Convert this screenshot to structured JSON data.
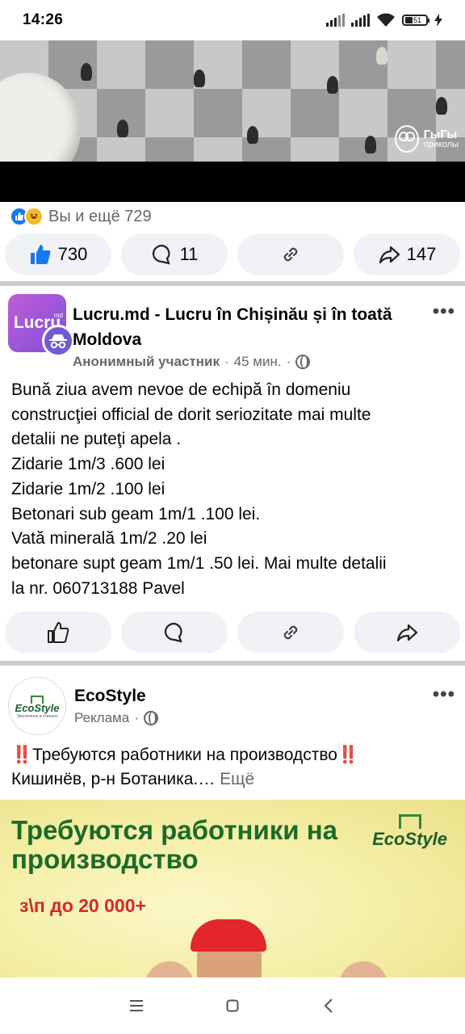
{
  "status_bar": {
    "time": "14:26",
    "battery_level": "51",
    "icons": [
      "signal-icon",
      "signal-icon",
      "wifi-icon",
      "battery-icon",
      "charging-icon"
    ]
  },
  "video_post": {
    "watermark_line1": "ГыГы",
    "watermark_line2": "приколы",
    "reactions_text": "Вы и ещё 729",
    "reaction_icons": [
      "like-icon",
      "haha-icon"
    ],
    "like_count": "730",
    "comment_count": "11",
    "share_count": "147"
  },
  "job_post": {
    "avatar_text": "Lucru",
    "avatar_superscript": "md",
    "title": "Lucru.md - Lucru în Chișinău și în toată Moldova",
    "author": "Анонимный участник",
    "time": "45 мин.",
    "separator": "·",
    "body": "Bună ziua avem nevoe de echipă în domeniu\nconstrucţiei official de dorit seriozitate mai multe\ndetalii ne puteţi apela .\nZidarie 1m/3 .600 lei\nZidarie 1m/2 .100 lei\nBetonari sub geam 1m/1 .100 lei.\nVată minerală 1m/2 .20 lei\nbetonare supt geam 1m/1 .50 lei.    Mai multe detalii\nla nr. 060713188 Pavel",
    "more_label": "•••"
  },
  "ad_post": {
    "page_name": "EcoStyle",
    "avatar_name": "EcoStyle",
    "avatar_tagline": "Экологично и стильно",
    "sponsored": "Реклама",
    "separator": "·",
    "text_line1": "Требуются работники на производство",
    "text_line2": "Кишинёв, р-н Ботаника.",
    "ellipsis": "…",
    "more_link": "Ещё",
    "bang": "‼️",
    "banner_headline": "Требуются работники на производство",
    "banner_logo": "EcoStyle",
    "banner_salary": "з\\п до 20 000+",
    "more_label": "•••"
  },
  "colors": {
    "facebook_blue": "#1877f2",
    "button_bg": "#f0f2f5",
    "meta_gray": "#65676b",
    "banner_green": "#1b6b2a",
    "banner_red": "#d8262c"
  },
  "nav_bar": {
    "icons": [
      "menu-icon",
      "home-square-icon",
      "back-chevron-icon"
    ]
  }
}
